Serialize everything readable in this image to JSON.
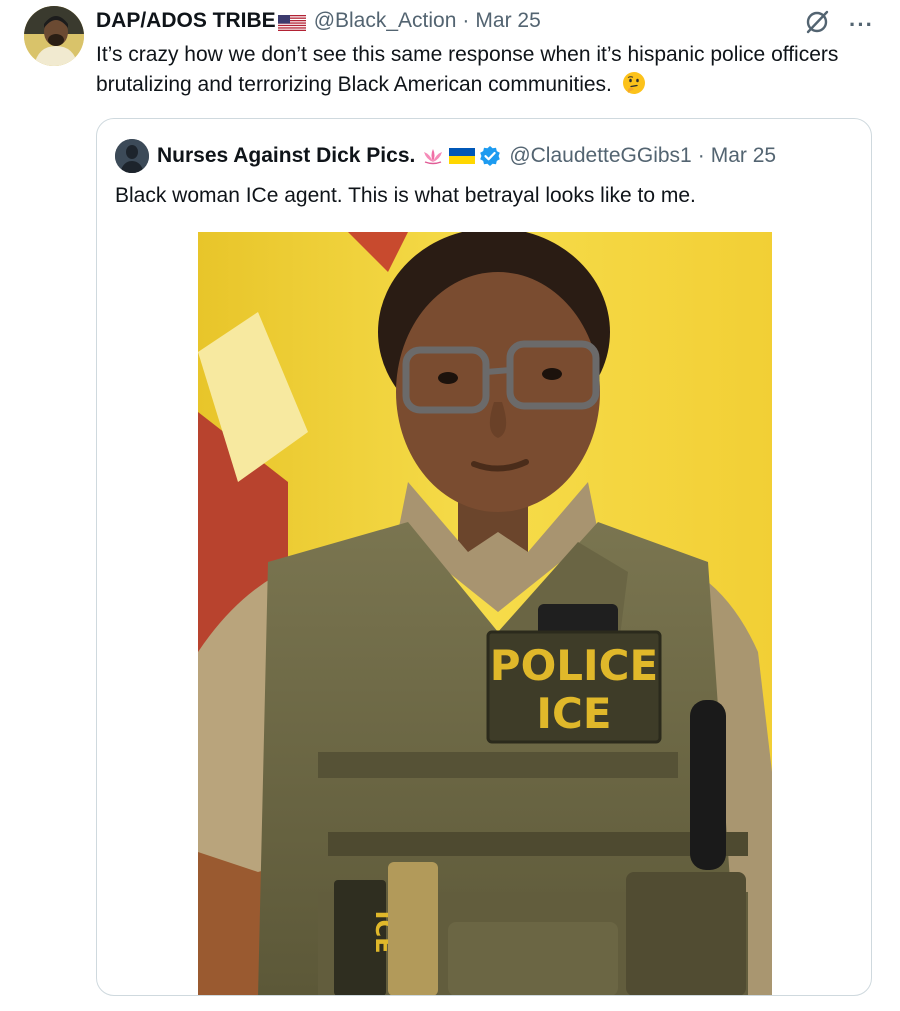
{
  "tweet": {
    "display_name": "DAP/ADOS TRIBE",
    "name_flag_icon": "us-flag-icon",
    "handle": "@Black_Action",
    "separator": "·",
    "date": "Mar 25",
    "text": "It’s crazy how we don’t see this same response when it’s hispanic police officers brutalizing and terrorizing Black American communities.",
    "text_emoji_icon": "thinking-face-icon",
    "actions": {
      "grok_icon": "grok-icon",
      "more_label": "···"
    }
  },
  "quote": {
    "display_name": "Nurses Against Dick Pics.",
    "name_icons": [
      "lotus-icon",
      "ukraine-flag-icon",
      "verified-badge-icon"
    ],
    "handle": "@ClaudetteGGibs1",
    "separator": "·",
    "date": "Mar 25",
    "text": "Black woman ICe agent. This is what betrayal looks like to me.",
    "image": {
      "patch_line1": "POLICE",
      "patch_line2": "ICE",
      "side_patch": "ICE"
    }
  },
  "colors": {
    "text": "#0f1419",
    "secondary": "#536471",
    "border": "#cfd9de",
    "verified": "#1d9bf0",
    "background_yellow": "#f4d63a",
    "vest": "#6f6a48"
  }
}
